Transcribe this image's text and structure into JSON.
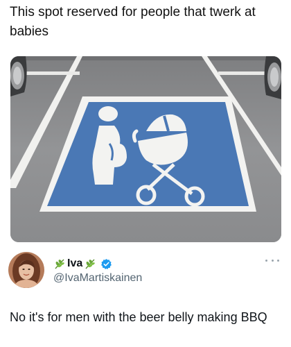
{
  "post": {
    "caption": "This spot reserved for people that twerk at babies",
    "image_alt": "Blue parking space marking with a figure leaning over a baby stroller shaped like a grill"
  },
  "reply": {
    "display_name": "Iva",
    "name_emoji": "leaf-emoji",
    "verified_icon": "verified-badge-icon",
    "handle": "@IvaMartiskainen",
    "text": "No it's for men with the beer belly making BBQ",
    "more_icon": "more-options-icon"
  },
  "colors": {
    "sign_blue": "#4a78b5",
    "asphalt": "#8c8d8f",
    "paint_white": "#f4f4f2",
    "verified_blue": "#1d9bf0",
    "handle_gray": "#536471"
  }
}
